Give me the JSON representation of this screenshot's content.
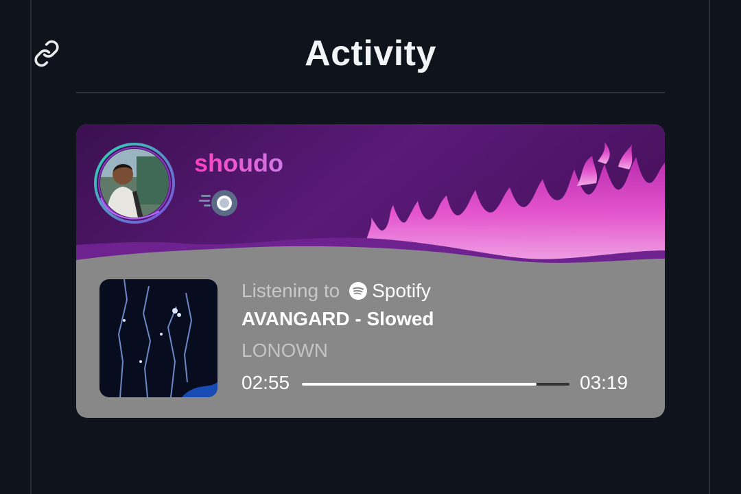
{
  "header": {
    "title": "Activity",
    "link_icon": "link-icon"
  },
  "profile": {
    "username": "shoudo",
    "username_colors": [
      "#ff3fbf",
      "#d07ae8"
    ],
    "status_icon": "activity-status-icon",
    "banner_icon": "purple-fire-banner",
    "avatar_icon": "user-avatar"
  },
  "activity": {
    "listening_label": "Listening to",
    "platform": "Spotify",
    "platform_icon": "spotify-icon",
    "track_title": "AVANGARD - Slowed",
    "artist": "LONOWN",
    "elapsed": "02:55",
    "duration": "03:19",
    "progress_fraction": 0.877
  },
  "colors": {
    "page_background": "#0f131b",
    "banner_purple": "#6a1a86",
    "card_body": "#888888",
    "progress_fill": "#ffffff",
    "progress_track": "#333333"
  }
}
